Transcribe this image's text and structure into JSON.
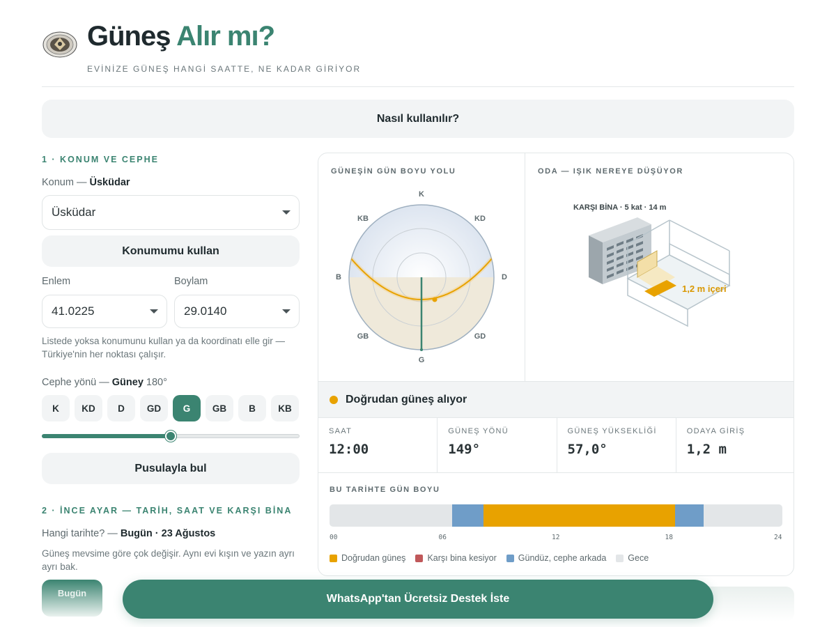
{
  "header": {
    "title_main": "Güneş",
    "title_accent": "Alır mı?",
    "subtitle": "EVİNİZE GÜNEŞ HANGİ SAATTE, NE KADAR GİRİYOR"
  },
  "howto_label": "Nasıl kullanılır?",
  "location": {
    "section_title": "1 · KONUM VE CEPHE",
    "label_prefix": "Konum —",
    "label_value": "Üsküdar",
    "select_value": "Üsküdar",
    "use_my_location": "Konumumu kullan",
    "lat_label": "Enlem",
    "lat_value": "41.0225",
    "lon_label": "Boylam",
    "lon_value": "29.0140",
    "hint": "Listede yoksa konumunu kullan ya da koordinatı elle gir — Türkiye'nin her noktası çalışır."
  },
  "facade": {
    "label_prefix": "Cephe yönü —",
    "label_value": "Güney",
    "label_deg": "180°",
    "directions": [
      "K",
      "KD",
      "D",
      "GD",
      "G",
      "GB",
      "B",
      "KB"
    ],
    "active": "G",
    "slider_fraction": 0.5,
    "compass_button": "Pusulayla bul"
  },
  "fine_tune": {
    "section_title": "2 · İNCE AYAR — TARİH, SAAT VE KARŞI BİNA",
    "date_label_prefix": "Hangi tarihte? —",
    "date_label_value": "Bugün · 23 Ağustos",
    "date_hint": "Güneş mevsime göre çok değişir. Aynı evi kışın ve yazın ayrı ayrı bak.",
    "partial_chip": "Bugün"
  },
  "sun_path": {
    "title": "GÜNEŞİN GÜN BOYU YOLU",
    "compass": {
      "K": "K",
      "KD": "KD",
      "D": "D",
      "GD": "GD",
      "G": "G",
      "GB": "GB",
      "B": "B",
      "KB": "KB"
    }
  },
  "room": {
    "title": "ODA — IŞIK NEREYE DÜŞÜYOR",
    "building_label": "KARŞI BİNA · 5 kat · 14 m",
    "depth_label": "1,2 m içeri"
  },
  "status": {
    "text": "Doğrudan güneş alıyor",
    "color": "#e8a200"
  },
  "stats": [
    {
      "key": "SAAT",
      "value": "12:00"
    },
    {
      "key": "GÜNEŞ YÖNÜ",
      "value": "149°"
    },
    {
      "key": "GÜNEŞ YÜKSEKLİĞİ",
      "value": "57,0°"
    },
    {
      "key": "ODAYA GİRİŞ",
      "value": "1,2 m"
    }
  ],
  "day": {
    "title": "BU TARİHTE GÜN BOYU",
    "ticks": [
      "00",
      "06",
      "12",
      "18",
      "24"
    ],
    "segments": [
      {
        "from": 0,
        "to": 6.5,
        "type": "night"
      },
      {
        "from": 6.5,
        "to": 8.17,
        "type": "shade"
      },
      {
        "from": 8.17,
        "to": 18.33,
        "type": "sun"
      },
      {
        "from": 18.33,
        "to": 19.83,
        "type": "shade"
      },
      {
        "from": 19.83,
        "to": 24,
        "type": "night"
      }
    ],
    "legend": [
      {
        "label": "Doğrudan güneş",
        "color": "#e8a200"
      },
      {
        "label": "Karşı bina kesiyor",
        "color": "#c0585a"
      },
      {
        "label": "Gündüz, cephe arkada",
        "color": "#6f9dc8"
      },
      {
        "label": "Gece",
        "color": "#e3e6e8"
      }
    ]
  },
  "cta": "WhatsApp'tan Ücretsiz Destek İste"
}
